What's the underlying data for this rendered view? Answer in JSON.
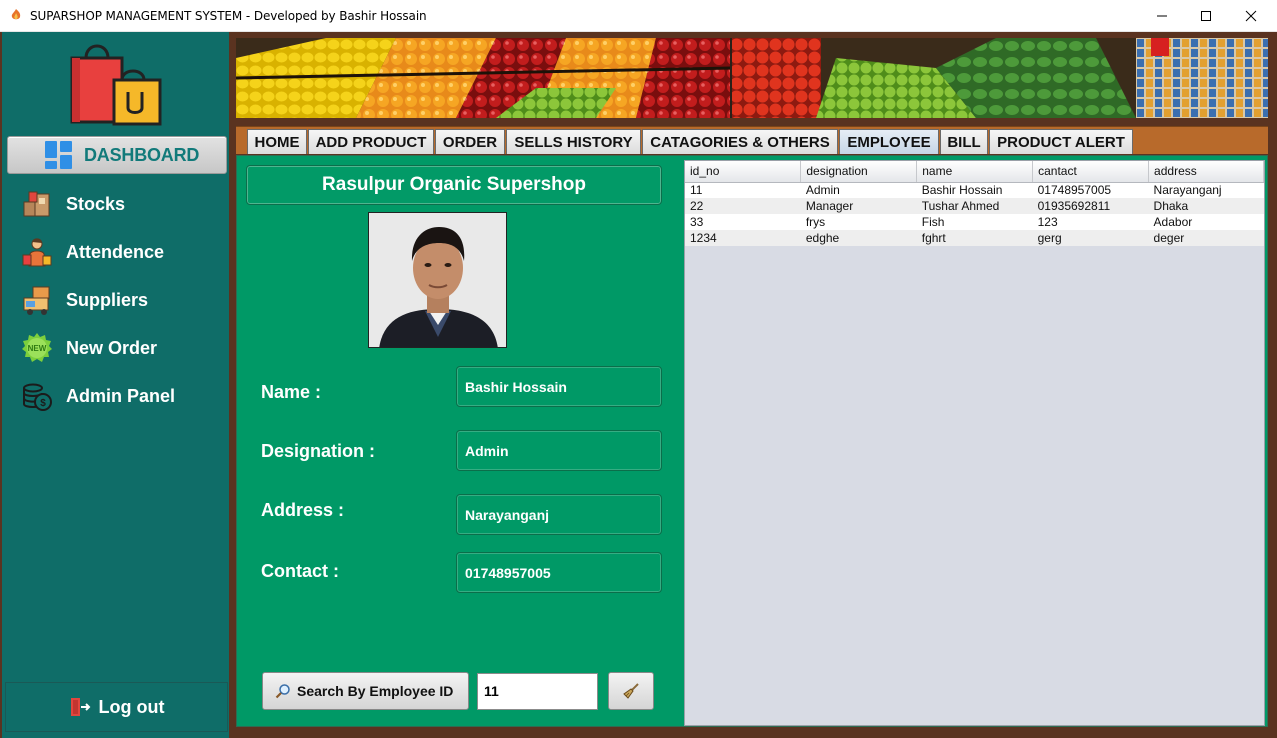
{
  "window": {
    "title": "SUPARSHOP MANAGEMENT SYSTEM  - Developed by Bashir Hossain"
  },
  "sidebar": {
    "dashboard_label": "DASHBOARD",
    "items": [
      {
        "label": "Stocks",
        "icon": "boxes-icon"
      },
      {
        "label": "Attendence",
        "icon": "shopper-icon"
      },
      {
        "label": "Suppliers",
        "icon": "delivery-icon"
      },
      {
        "label": "New Order",
        "icon": "new-badge-icon"
      },
      {
        "label": "Admin Panel",
        "icon": "coins-icon"
      }
    ],
    "logout_label": "Log out"
  },
  "tabs": [
    {
      "label": "HOME"
    },
    {
      "label": "ADD PRODUCT"
    },
    {
      "label": "ORDER"
    },
    {
      "label": "SELLS HISTORY"
    },
    {
      "label": "CATAGORIES & OTHERS"
    },
    {
      "label": "EMPLOYEE"
    },
    {
      "label": "BILL"
    },
    {
      "label": "PRODUCT ALERT"
    }
  ],
  "active_tab": "EMPLOYEE",
  "employee": {
    "shop_name": "Rasulpur Organic Supershop",
    "fields": [
      {
        "label": "Name :",
        "value": "Bashir Hossain"
      },
      {
        "label": "Designation :",
        "value": "Admin"
      },
      {
        "label": "Address :",
        "value": "Narayanganj"
      },
      {
        "label": "Contact :",
        "value": "01748957005"
      }
    ],
    "search_button_label": "Search By Employee ID",
    "search_value": "11"
  },
  "table": {
    "columns": [
      "id_no",
      "designation",
      "name",
      "cantact",
      "address"
    ],
    "rows": [
      [
        "11",
        "Admin",
        "Bashir Hossain",
        "01748957005",
        "Narayanganj"
      ],
      [
        "22",
        "Manager",
        "Tushar Ahmed",
        "01935692811",
        "Dhaka"
      ],
      [
        "33",
        "frys",
        "Fish",
        "123",
        "Adabor"
      ],
      [
        "1234",
        "edghe",
        "fghrt",
        "gerg",
        "deger"
      ]
    ]
  },
  "colors": {
    "sidebar_bg": "#0f6d68",
    "content_bg": "#009966",
    "tabstrip_bg": "#b86a2b",
    "frame_bg": "#5a3320"
  }
}
